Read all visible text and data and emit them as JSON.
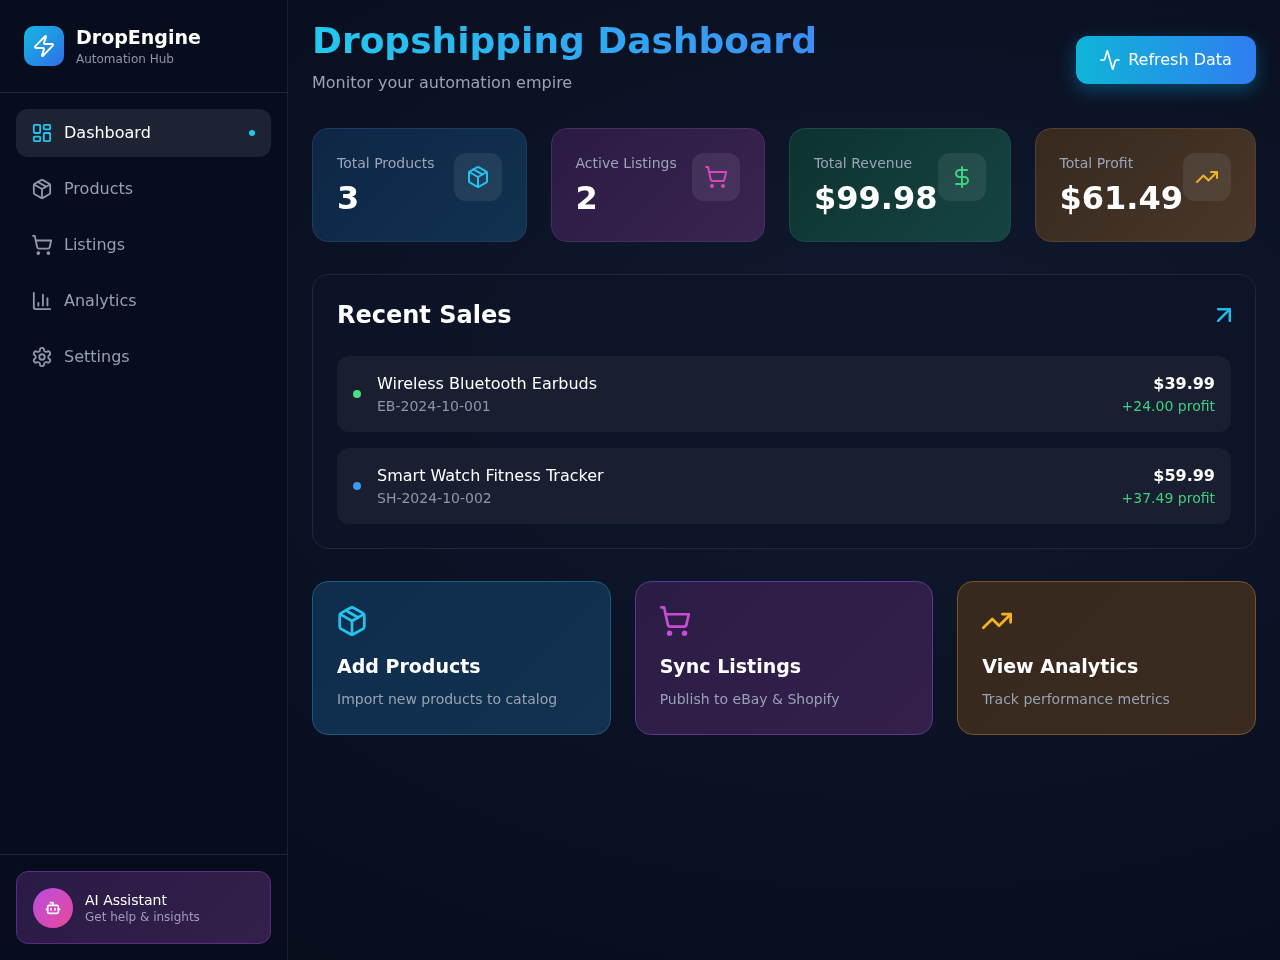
{
  "sidebar": {
    "brand": {
      "name": "DropEngine",
      "tagline": "Automation Hub"
    },
    "nav": [
      {
        "kind": "dashboard",
        "label": "Dashboard",
        "selected": true
      },
      {
        "kind": "products",
        "label": "Products",
        "selected": false
      },
      {
        "kind": "listings",
        "label": "Listings",
        "selected": false
      },
      {
        "kind": "analytics",
        "label": "Analytics",
        "selected": false
      },
      {
        "kind": "settings",
        "label": "Settings",
        "selected": false
      }
    ],
    "assistant": {
      "title": "AI Assistant",
      "subtitle": "Get help & insights"
    }
  },
  "header": {
    "title": "Dropshipping Dashboard",
    "subtitle": "Monitor your automation empire",
    "refresh_button": "Refresh Data"
  },
  "stats": [
    {
      "kind": "products",
      "label": "Total Products",
      "value": "3"
    },
    {
      "kind": "listings",
      "label": "Active Listings",
      "value": "2"
    },
    {
      "kind": "revenue",
      "label": "Total Revenue",
      "value": "$99.98"
    },
    {
      "kind": "profit",
      "label": "Total Profit",
      "value": "$61.49"
    }
  ],
  "recent_sales": {
    "title": "Recent Sales",
    "items": [
      {
        "name": "Wireless Bluetooth Earbuds",
        "order_id": "EB-2024-10-001",
        "price": "$39.99",
        "profit": "+24.00 profit",
        "color": "#4ade80"
      },
      {
        "name": "Smart Watch Fitness Tracker",
        "order_id": "SH-2024-10-002",
        "price": "$59.99",
        "profit": "+37.49 profit",
        "color": "#3b9af2"
      }
    ]
  },
  "actions": [
    {
      "kind": "products",
      "title": "Add Products",
      "description": "Import new products to catalog"
    },
    {
      "kind": "listings",
      "title": "Sync Listings",
      "description": "Publish to eBay & Shopify"
    },
    {
      "kind": "analytics",
      "title": "View Analytics",
      "description": "Track performance metrics"
    }
  ]
}
